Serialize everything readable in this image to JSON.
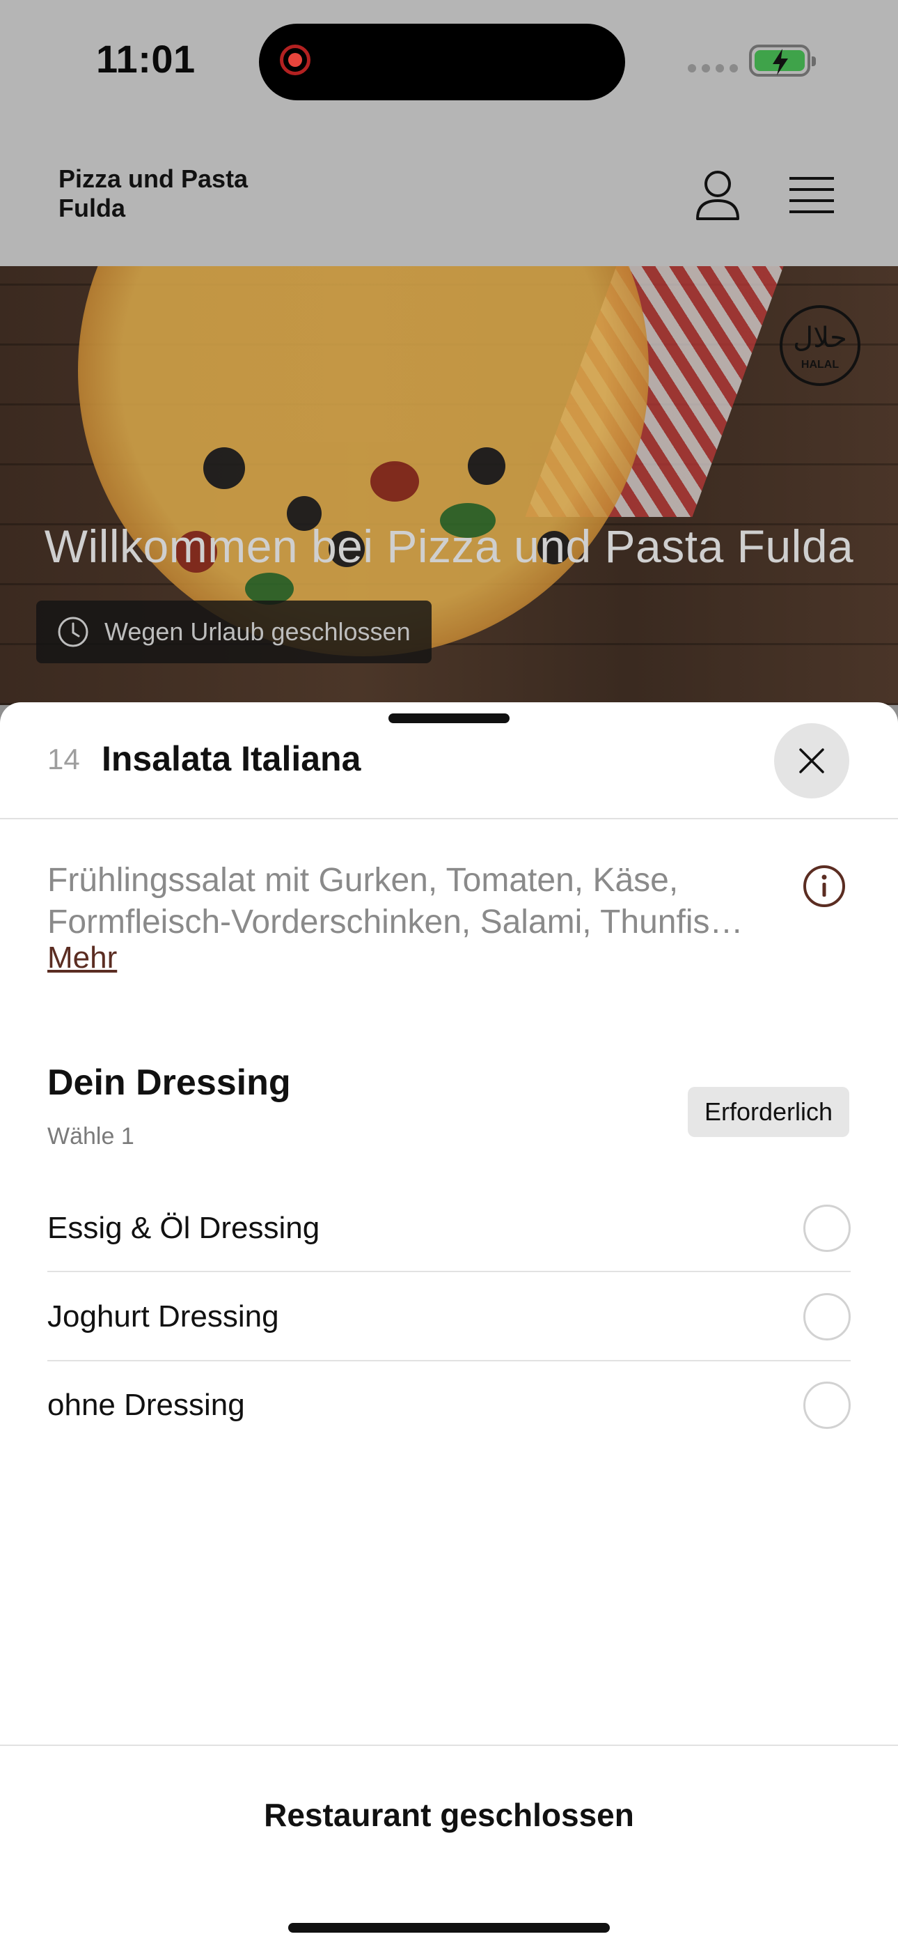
{
  "status_bar": {
    "time": "11:01"
  },
  "header": {
    "restaurant_name": "Pizza und Pasta Fulda"
  },
  "hero": {
    "title": "Willkommen bei Pizza und Pasta Fulda",
    "status_text": "Wegen Urlaub geschlossen",
    "badge_arabic": "حلال",
    "badge_text": "HALAL"
  },
  "item": {
    "number": "14",
    "title": "Insalata Italiana",
    "description_line1": "Frühlingssalat mit Gurken, Tomaten, Käse,",
    "description_line2": "Formfleisch-Vorderschinken, Salami, Thunfis…",
    "more_label": "Mehr"
  },
  "options_group": {
    "title": "Dein Dressing",
    "subtitle": "Wähle 1",
    "required_label": "Erforderlich",
    "options": [
      {
        "label": "Essig & Öl Dressing",
        "selected": false
      },
      {
        "label": "Joghurt Dressing",
        "selected": false
      },
      {
        "label": "ohne Dressing",
        "selected": false
      }
    ]
  },
  "footer": {
    "button_label": "Restaurant geschlossen"
  },
  "colors": {
    "link": "#5b2d22",
    "battery_fill": "#3fa34a",
    "recording": "#e8453c"
  }
}
